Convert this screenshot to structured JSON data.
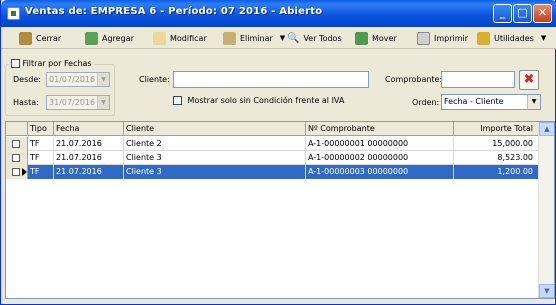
{
  "window": {
    "title": "Ventas de: EMPRESA 6 - Período: 07 2016 - Abierto"
  },
  "toolbar": {
    "cerrar": "Cerrar",
    "agregar": "Agregar",
    "modificar": "Modificar",
    "eliminar": "Eliminar",
    "ver_todos": "Ver Todos",
    "mover": "Mover",
    "imprimir": "Imprimir",
    "utilidades": "Utilidades"
  },
  "filters": {
    "filtrar_label": "Filtrar por Fechas",
    "desde_label": "Desde:",
    "desde_value": "01/07/2016",
    "hasta_label": "Hasta:",
    "hasta_value": "31/07/2016",
    "cliente_label": "Cliente:",
    "cliente_value": "",
    "comprobante_label": "Comprobante:",
    "comprobante_value": "",
    "iva_label": "Mostrar solo sin Condición frente al IVA",
    "orden_label": "Orden:",
    "orden_value": "Fecha - Cliente"
  },
  "table": {
    "headers": [
      "Tipo",
      "Fecha",
      "Cliente",
      "Nº Comprobante",
      "Importe Total"
    ],
    "rows": [
      [
        "TF",
        "21.07.2016",
        "Cliente 2",
        "A-1-00000001 00000000",
        "15,000.00"
      ],
      [
        "TF",
        "21.07.2016",
        "Cliente 3",
        "A-1-00000002 00000000",
        "8,523.00"
      ],
      [
        "TF",
        "21.07.2016",
        "Cliente 3",
        "A-1-00000003 00000000",
        "1,200.00"
      ]
    ],
    "selected_row": 2
  },
  "colors": {
    "titlebar": "#0a52dd",
    "selection": "#316ac5",
    "toolbar_bg": "#ece9d8"
  },
  "icons": [
    "app-icon",
    "door-icon",
    "add-icon",
    "edit-icon",
    "delete-icon",
    "search-icon",
    "move-icon",
    "print-icon",
    "tools-icon",
    "close-x-icon"
  ]
}
